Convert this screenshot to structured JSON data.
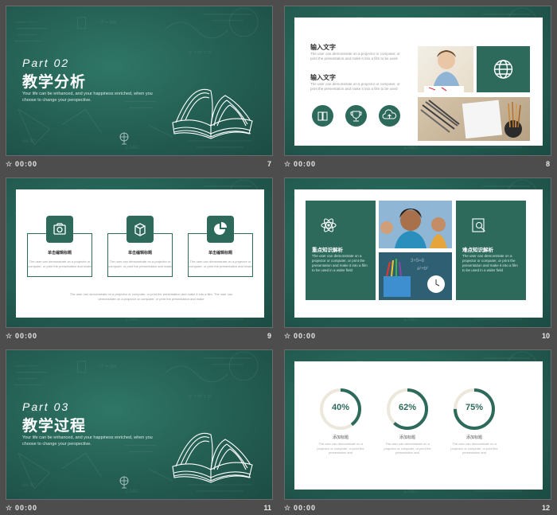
{
  "colors": {
    "accent": "#2d6a5c",
    "board": "#245e53",
    "canvas": "#4d4d4d"
  },
  "footer_time": "00:00",
  "slides": [
    {
      "num": "7",
      "part": "Part 02",
      "title": "教学分析",
      "subtitle": "Your life can be enhanced, and your happiness enriched, when you choose to change your perspective."
    },
    {
      "num": "8",
      "items": [
        {
          "title": "输入文字",
          "body": "The user can demonstrate on a projector or computer, or print the presentation and make it into a film to be used"
        },
        {
          "title": "输入文字",
          "body": "The user can demonstrate on a projector or computer, or print the presentation and make it into a film to be used"
        }
      ],
      "icons": [
        "book-icon",
        "trophy-icon",
        "cloud-icon",
        "globe-icon"
      ]
    },
    {
      "num": "9",
      "boxes": [
        {
          "title": "单击编辑标题",
          "body": "The user can demonstrate on a projector or computer, or print the presentation and make",
          "icon": "camera-icon"
        },
        {
          "title": "单击编辑标题",
          "body": "The user can demonstrate on a projector or computer, or print the presentation and make",
          "icon": "box-icon"
        },
        {
          "title": "单击编辑标题",
          "body": "The user can demonstrate on a projector or computer, or print the presentation and make",
          "icon": "pie-chart-icon"
        }
      ],
      "footer": "The user can demonstrate on a projector or computer, or print the presentation and make it into a film. The user can demonstrate on a projector or computer, or print the presentation and make"
    },
    {
      "num": "10",
      "left": {
        "title": "重点知识解析",
        "body": "The user can demonstrate on a projector or computer, or print the presentation and make it into a film to be used in a wider field",
        "icon": "atom-icon"
      },
      "right": {
        "title": "难点知识解析",
        "body": "The user can demonstrate on a projector or computer, or print the presentation and make it into a film to be used in a wider field",
        "icon": "search-doc-icon"
      }
    },
    {
      "num": "11",
      "part": "Part 03",
      "title": "教学过程",
      "subtitle": "Your life can be enhanced, and your happiness enriched, when you choose to change your perspective."
    },
    {
      "num": "12",
      "rings": [
        {
          "label": "40%",
          "value": 0.4,
          "title": "添加标题",
          "body": "The user can demonstrate on a projector or computer, or print the presentation and"
        },
        {
          "label": "62%",
          "value": 0.62,
          "title": "添加标题",
          "body": "The user can demonstrate on a projector or computer, or print the presentation and"
        },
        {
          "label": "75%",
          "value": 0.75,
          "title": "添加标题",
          "body": "The user can demonstrate on a projector or computer, or print the presentation and"
        }
      ]
    }
  ]
}
